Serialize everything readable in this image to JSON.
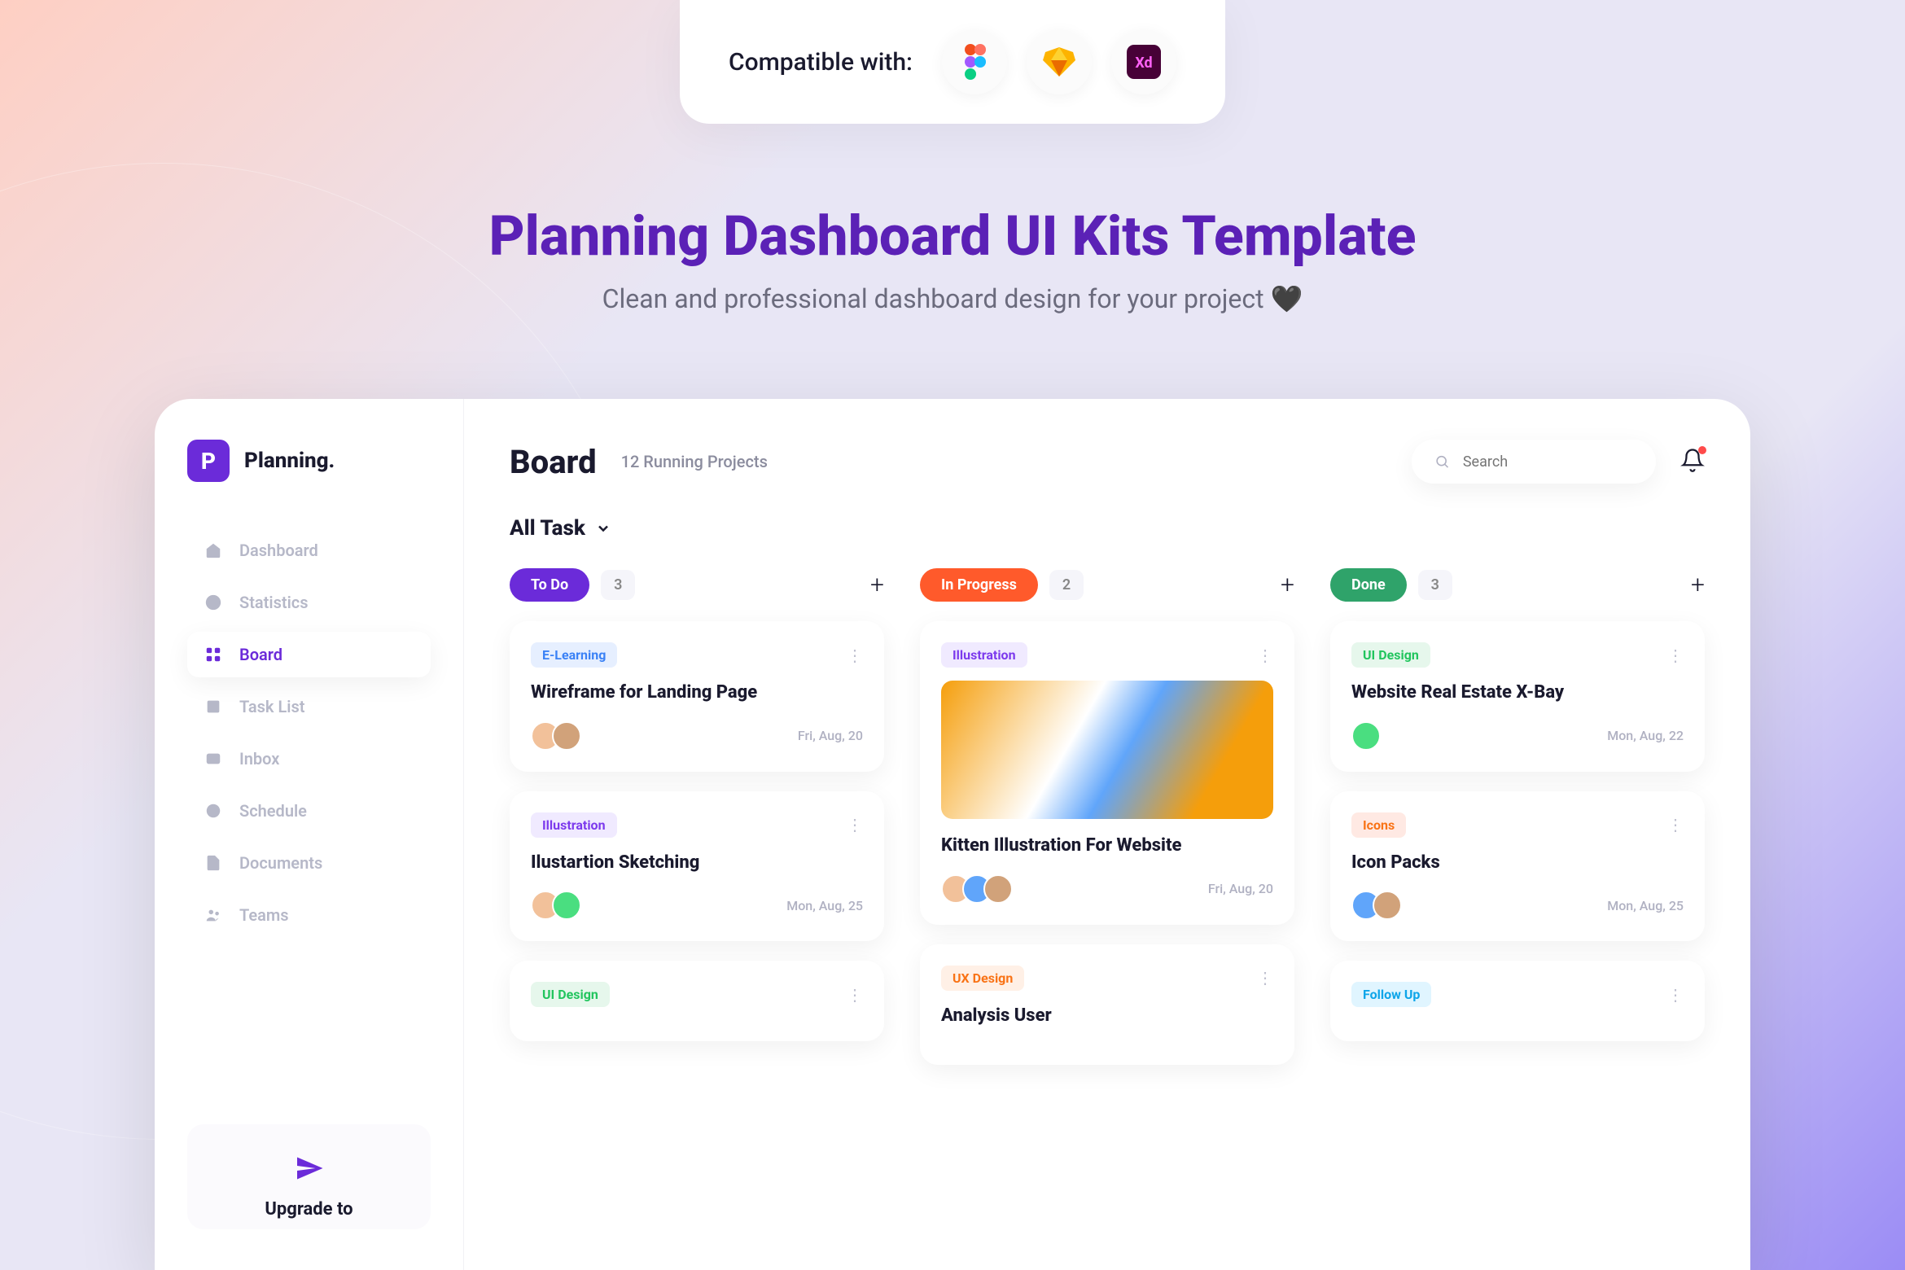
{
  "compat": {
    "label": "Compatible with:",
    "apps": [
      "figma",
      "sketch",
      "xd"
    ]
  },
  "hero": {
    "title": "Planning Dashboard UI Kits Template",
    "subtitle": "Clean and professional dashboard design for your project 🖤"
  },
  "brand": {
    "initial": "P",
    "name": "Planning."
  },
  "sidebar": {
    "items": [
      {
        "icon": "home",
        "label": "Dashboard"
      },
      {
        "icon": "pie",
        "label": "Statistics"
      },
      {
        "icon": "grid",
        "label": "Board"
      },
      {
        "icon": "list",
        "label": "Task List"
      },
      {
        "icon": "inbox",
        "label": "Inbox"
      },
      {
        "icon": "clock",
        "label": "Schedule"
      },
      {
        "icon": "doc",
        "label": "Documents"
      },
      {
        "icon": "team",
        "label": "Teams"
      }
    ],
    "active": 2,
    "upgrade": "Upgrade to"
  },
  "header": {
    "title": "Board",
    "subtitle": "12 Running Projects",
    "search_placeholder": "Search"
  },
  "filter": "All Task",
  "columns": [
    {
      "name": "To Do",
      "count": "3",
      "color": "#6b2bd9",
      "cards": [
        {
          "tag": "E-Learning",
          "tag_bg": "#e6efff",
          "tag_fg": "#3b82f6",
          "title": "Wireframe for Landing Page",
          "avatars": [
            "#f2c19a",
            "#d1a27a"
          ],
          "date": "Fri, Aug, 20"
        },
        {
          "tag": "Illustration",
          "tag_bg": "#f0eaff",
          "tag_fg": "#7c3aed",
          "title": "Ilustartion Sketching",
          "avatars": [
            "#f2c19a",
            "#4ade80"
          ],
          "date": "Mon, Aug, 25"
        },
        {
          "tag": "UI Design",
          "tag_bg": "#e6f7ec",
          "tag_fg": "#22c55e",
          "title": "",
          "avatars": [],
          "date": ""
        }
      ]
    },
    {
      "name": "In Progress",
      "count": "2",
      "color": "#ff5a2b",
      "cards": [
        {
          "tag": "Illustration",
          "tag_bg": "#f0eaff",
          "tag_fg": "#7c3aed",
          "title": "Kitten Illustration For Website",
          "image": true,
          "avatars": [
            "#f2c19a",
            "#60a5fa",
            "#d1a27a"
          ],
          "date": "Fri, Aug, 20"
        },
        {
          "tag": "UX Design",
          "tag_bg": "#fff0e6",
          "tag_fg": "#f97316",
          "title": "Analysis User",
          "avatars": [],
          "date": ""
        }
      ]
    },
    {
      "name": "Done",
      "count": "3",
      "color": "#2fa36a",
      "cards": [
        {
          "tag": "UI Design",
          "tag_bg": "#e6f7ec",
          "tag_fg": "#22c55e",
          "title": "Website Real Estate X-Bay",
          "avatars": [
            "#4ade80"
          ],
          "date": "Mon, Aug, 22"
        },
        {
          "tag": "Icons",
          "tag_bg": "#ffe9e3",
          "tag_fg": "#f97316",
          "title": "Icon Packs",
          "avatars": [
            "#60a5fa",
            "#d1a27a"
          ],
          "date": "Mon, Aug, 25"
        },
        {
          "tag": "Follow Up",
          "tag_bg": "#e0f5ff",
          "tag_fg": "#0ea5e9",
          "title": "",
          "avatars": [],
          "date": ""
        }
      ]
    }
  ]
}
